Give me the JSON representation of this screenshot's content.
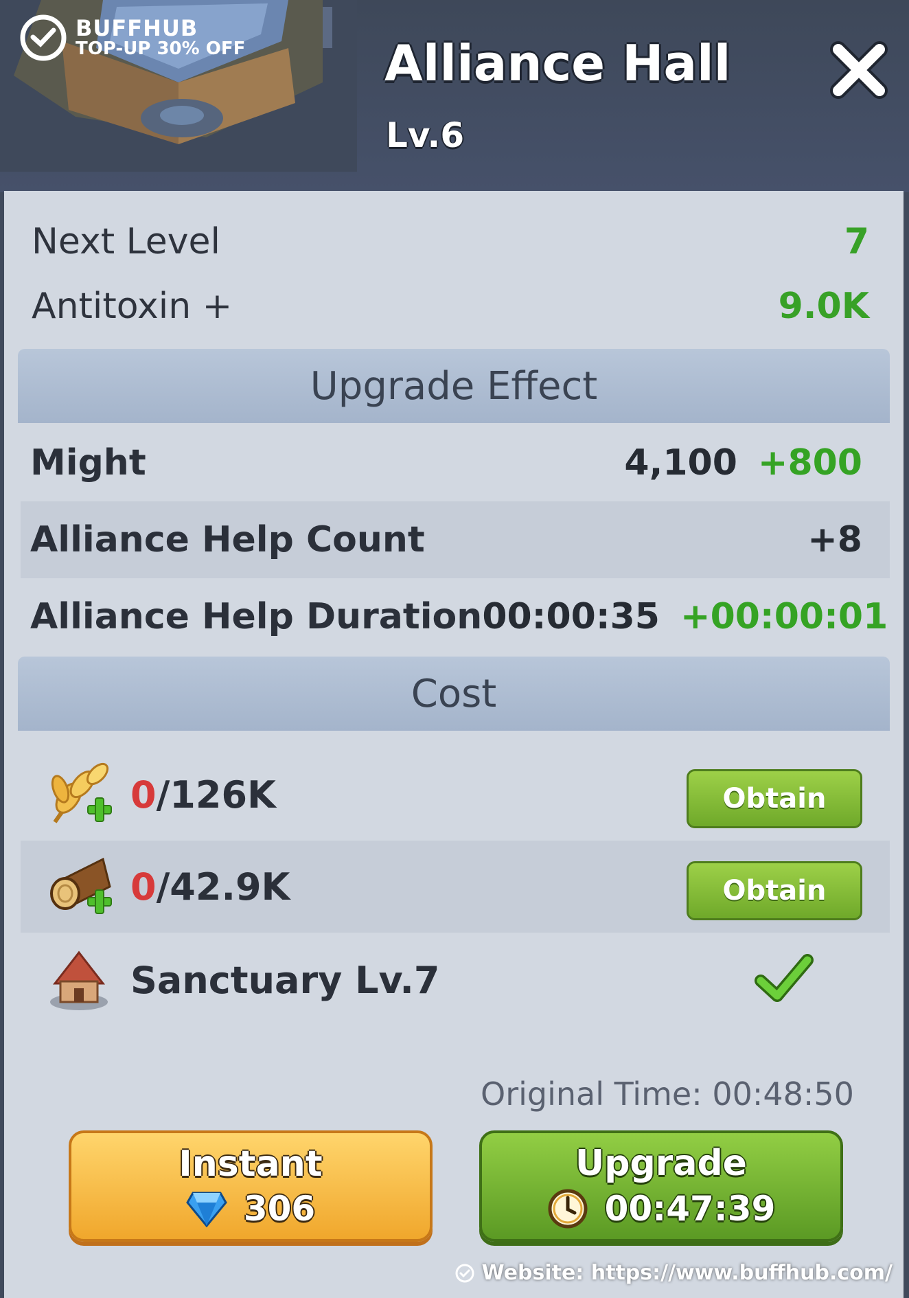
{
  "watermark": {
    "brand": "BUFFHUB",
    "promo": "TOP-UP 30% OFF",
    "website": "Website: https://www.buffhub.com/"
  },
  "header": {
    "title": "Alliance Hall",
    "level": "Lv.6",
    "close_icon": "close-x-icon"
  },
  "next_level": {
    "label": "Next Level",
    "value": "7"
  },
  "antitoxin": {
    "label": "Antitoxin +",
    "value": "9.0K"
  },
  "upgrade_effect": {
    "heading": "Upgrade Effect",
    "rows": [
      {
        "label": "Might",
        "current": "4,100",
        "bonus": "+800"
      },
      {
        "label": "Alliance Help Count",
        "current": "",
        "bonus": "+8"
      },
      {
        "label": "Alliance Help Duration",
        "current": "00:00:35",
        "bonus": "+00:00:01"
      }
    ]
  },
  "cost": {
    "heading": "Cost",
    "resources": [
      {
        "icon": "wheat-icon",
        "have": "0",
        "need": "/126K",
        "button": "Obtain"
      },
      {
        "icon": "wood-log-icon",
        "have": "0",
        "need": "/42.9K",
        "button": "Obtain"
      }
    ],
    "requirement": {
      "icon": "sanctuary-building-icon",
      "label": "Sanctuary Lv.7",
      "status_icon": "checkmark-icon"
    }
  },
  "original_time": "Original Time: 00:48:50",
  "actions": {
    "instant": {
      "label": "Instant",
      "gems": "306",
      "icon": "gem-icon"
    },
    "upgrade": {
      "label": "Upgrade",
      "time": "00:47:39",
      "icon": "clock-icon"
    }
  },
  "colors": {
    "accent_green": "#38a127",
    "deficit_red": "#d73a3a",
    "panel_bg": "#d2d8e1",
    "header_bg": "#404a5c"
  }
}
